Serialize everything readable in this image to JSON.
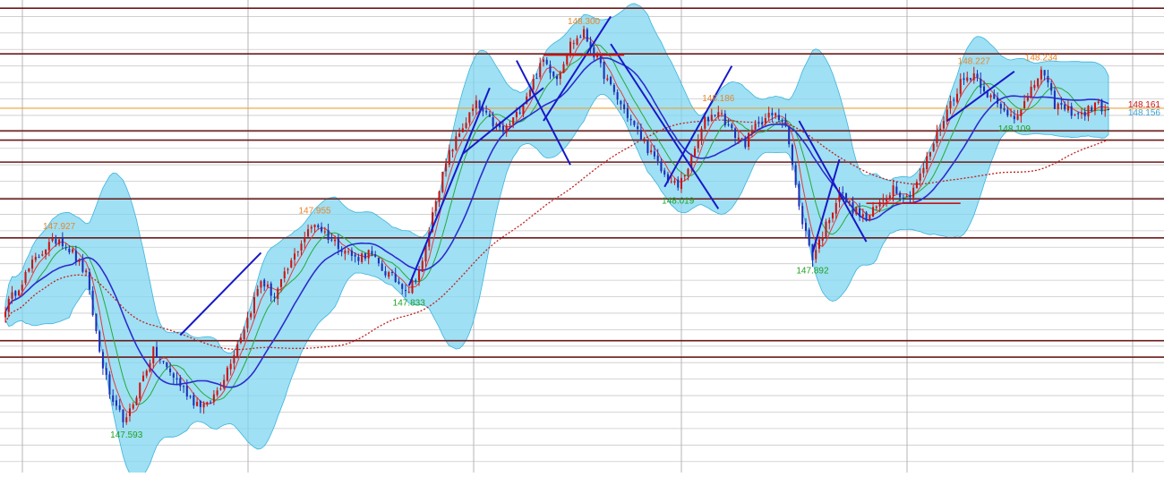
{
  "chart_data": {
    "type": "candlestick",
    "title": "",
    "xlabel": "",
    "ylabel": "",
    "ylim": [
      147.5,
      148.36
    ],
    "grid": true,
    "colors": {
      "bull": "#1f2fb8",
      "bear": "#cc1414",
      "band_fill": "#7fd6f0",
      "band_edge": "#3db3dc",
      "ma_fast": "#e23b3b",
      "ma_mid": "#27a83a",
      "ma_slow": "#2c2ccf",
      "ma_long": "#c02020",
      "level_line": "#6a1a1a",
      "current_line": "#f0a030",
      "trendline": "#1818c8",
      "high_label": "#e8862c",
      "low_label": "#20a020"
    },
    "price_path": [
      147.8,
      147.84,
      147.88,
      147.91,
      147.927,
      147.9,
      147.86,
      147.72,
      147.62,
      147.593,
      147.66,
      147.72,
      147.69,
      147.66,
      147.63,
      147.62,
      147.66,
      147.72,
      147.78,
      147.85,
      147.82,
      147.87,
      147.92,
      147.955,
      147.93,
      147.91,
      147.89,
      147.9,
      147.87,
      147.85,
      147.833,
      147.88,
      148.0,
      148.08,
      148.13,
      148.17,
      148.14,
      148.12,
      148.15,
      148.2,
      148.25,
      148.22,
      148.28,
      148.3,
      148.25,
      148.2,
      148.16,
      148.12,
      148.08,
      148.04,
      148.019,
      148.07,
      148.14,
      148.16,
      148.12,
      148.1,
      148.14,
      148.15,
      148.14,
      147.98,
      147.892,
      147.95,
      148.01,
      147.98,
      147.96,
      147.99,
      148.02,
      148.0,
      148.04,
      148.1,
      148.16,
      148.21,
      148.227,
      148.19,
      148.16,
      148.15,
      148.18,
      148.234,
      148.17,
      148.16,
      148.15,
      148.17,
      148.16
    ],
    "annotations": [
      {
        "text": "147.927",
        "index": 4,
        "kind": "high"
      },
      {
        "text": "147.593",
        "index": 9,
        "kind": "low"
      },
      {
        "text": "147.955",
        "index": 23,
        "kind": "high"
      },
      {
        "text": "147.833",
        "index": 30,
        "kind": "low"
      },
      {
        "text": "148.300",
        "index": 43,
        "kind": "high"
      },
      {
        "text": "148.186",
        "index": 53,
        "kind": "high"
      },
      {
        "text": "148.019",
        "index": 50,
        "kind": "low"
      },
      {
        "text": "147.892",
        "index": 60,
        "kind": "low"
      },
      {
        "text": "148.227",
        "index": 72,
        "kind": "high"
      },
      {
        "text": "148.234",
        "index": 77,
        "kind": "high"
      },
      {
        "text": "148.109",
        "index": 75,
        "kind": "low"
      },
      {
        "text": "148.161",
        "index": 82,
        "kind": "price_tag"
      },
      {
        "text": "148.156",
        "index": 82,
        "kind": "price_tag_alt"
      }
    ],
    "horizontal_levels": [
      148.345,
      148.262,
      148.122,
      148.105,
      148.065,
      147.998,
      147.927,
      147.74,
      147.71
    ],
    "current_price_line": 148.163,
    "vertical_separators": 6
  }
}
